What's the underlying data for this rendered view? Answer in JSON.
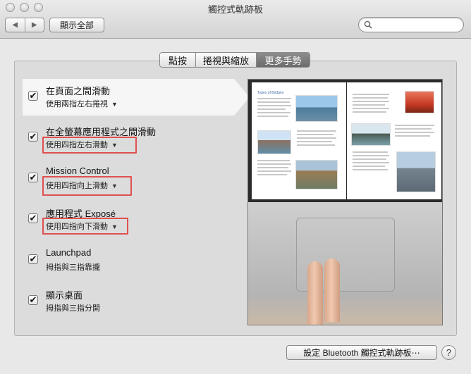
{
  "window": {
    "title": "觸控式軌跡板"
  },
  "toolbar": {
    "back_icon": "◀",
    "forward_icon": "▶",
    "show_all_label": "顯示全部",
    "search_placeholder": ""
  },
  "tabs": [
    {
      "label": "點按",
      "active": false
    },
    {
      "label": "捲視與縮放",
      "active": false
    },
    {
      "label": "更多手勢",
      "active": true
    }
  ],
  "gestures": [
    {
      "title": "在頁面之間滑動",
      "subtitle": "使用兩指左右捲視",
      "checked": true,
      "has_menu": true
    },
    {
      "title": "在全螢幕應用程式之間滑動",
      "subtitle": "使用四指左右滑動",
      "checked": true,
      "has_menu": true
    },
    {
      "title": "Mission Control",
      "subtitle": "使用四指向上滑動",
      "checked": true,
      "has_menu": true
    },
    {
      "title": "應用程式 Exposé",
      "subtitle": "使用四指向下滑動",
      "checked": true,
      "has_menu": true
    },
    {
      "title": "Launchpad",
      "subtitle": "拇指與三指靠攏",
      "checked": true,
      "has_menu": false
    },
    {
      "title": "顯示桌面",
      "subtitle": "拇指與三指分開",
      "checked": true,
      "has_menu": false
    }
  ],
  "checkmark": "✔",
  "menu_arrow": "▼",
  "preview": {
    "page_heading": "Types of Bridges"
  },
  "bottom": {
    "bluetooth_button": "設定 Bluetooth 觸控式軌跡板⋯",
    "help_label": "?"
  },
  "colors": {
    "highlight": "#e05050",
    "active_tab": "#7a7a7a"
  }
}
